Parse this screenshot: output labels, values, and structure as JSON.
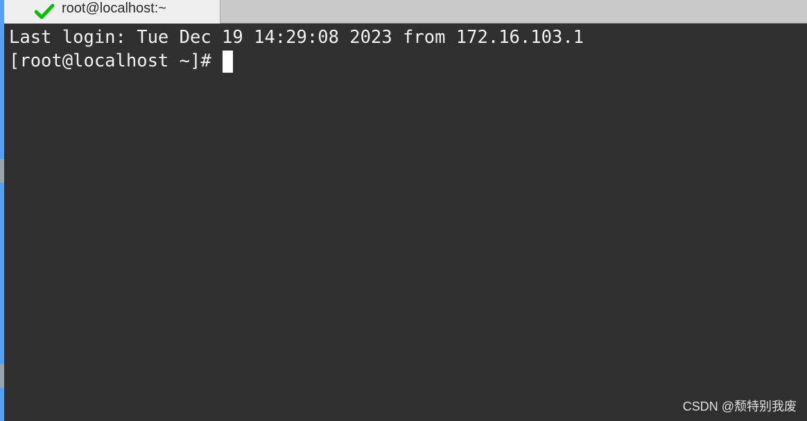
{
  "tab": {
    "title": "root@localhost:~",
    "icon": "checkmark-icon",
    "icon_color": "#00c000"
  },
  "terminal": {
    "background": "#303030",
    "foreground": "#f2f2f2",
    "lines": [
      "Last login: Tue Dec 19 14:29:08 2023 from 172.16.103.1"
    ],
    "prompt": "[root@localhost ~]#"
  },
  "watermark": "CSDN @颓特别我废"
}
